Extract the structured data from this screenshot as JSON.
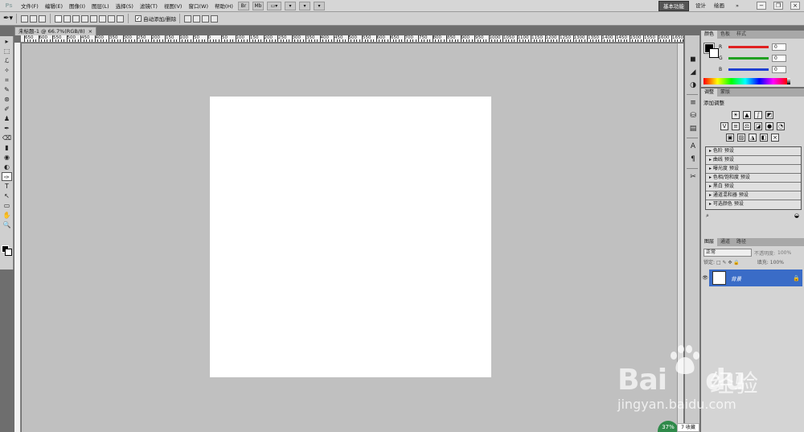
{
  "app": {
    "logo": "Ps"
  },
  "menu": [
    "文件(F)",
    "编辑(E)",
    "图像(I)",
    "图层(L)",
    "选择(S)",
    "滤镜(T)",
    "视图(V)",
    "窗口(W)",
    "帮助(H)"
  ],
  "menubar_buttons": [
    "Br",
    "Mb",
    "▭▾",
    "▾",
    "▾",
    "▾"
  ],
  "workspaces": {
    "active": "基本功能",
    "design": "设计",
    "painting": "绘画"
  },
  "options": {
    "auto_add_delete": "自动添加/删除"
  },
  "document": {
    "tab_label": "未标题-1 @ 66.7%(RGB/8)",
    "close": "×"
  },
  "ruler_labels": [
    "650",
    "600",
    "550",
    "500",
    "450",
    "400",
    "350",
    "300",
    "250",
    "200",
    "150",
    "100",
    "50",
    "0",
    "50",
    "100",
    "150",
    "200",
    "250",
    "300",
    "350",
    "400",
    "450",
    "500",
    "550",
    "600",
    "650",
    "700",
    "750",
    "800",
    "850",
    "900",
    "950",
    "1000",
    "1050",
    "1100",
    "1150",
    "1200",
    "1250",
    "1300",
    "1350",
    "1400",
    "1450",
    "1500",
    "1550",
    "1600",
    "1650"
  ],
  "tools": [
    "▸",
    "⬚",
    "ℒ",
    "✧",
    "⌗",
    "✎",
    "⊛",
    "✐",
    "♟",
    "✒",
    "⌫",
    "▮",
    "◉",
    "◐",
    "✑",
    "T",
    "↖",
    "▭",
    "✋",
    "🔍"
  ],
  "dock_icons": [
    "◼",
    "◢",
    "◑",
    "≡",
    "⛁",
    "▤",
    "A",
    "¶",
    "✂"
  ],
  "color_panel": {
    "tabs": [
      "颜色",
      "色板",
      "样式"
    ],
    "channels": [
      {
        "label": "R",
        "value": "0",
        "color": "#e02020"
      },
      {
        "label": "G",
        "value": "0",
        "color": "#20a020"
      },
      {
        "label": "B",
        "value": "0",
        "color": "#2040d0"
      }
    ]
  },
  "adjust_panel": {
    "tabs": [
      "调整",
      "蒙版"
    ],
    "title": "添加调整",
    "row1": [
      "☀",
      "▲",
      "∫",
      "◩"
    ],
    "row2": [
      "V",
      "≡",
      "⚖",
      "◪",
      "●",
      "◔"
    ],
    "row3": [
      "▣",
      "▨",
      "◮",
      "◧",
      "⨯"
    ],
    "presets": [
      "色阶 预设",
      "曲线 预设",
      "曝光度 预设",
      "色相/饱和度 预设",
      "黑白 预设",
      "通道混和器 预设",
      "可选颜色 预设"
    ],
    "footer_left": "⌕",
    "footer_right": "◒"
  },
  "layers_panel": {
    "tabs": [
      "图层",
      "通道",
      "路径"
    ],
    "blend_mode": "正常",
    "opacity_label": "不透明度:",
    "opacity": "100%",
    "lock_label": "锁定:",
    "fill_label": "填充:",
    "fill": "100%",
    "layers": [
      {
        "name": "背景",
        "visible": true
      }
    ]
  },
  "watermark": {
    "brand": "Bai",
    "brand2": "du",
    "cn": "经验",
    "url": "jingyan.baidu.com"
  },
  "zoom_badge": "37%",
  "status_mini": "7 收藏"
}
